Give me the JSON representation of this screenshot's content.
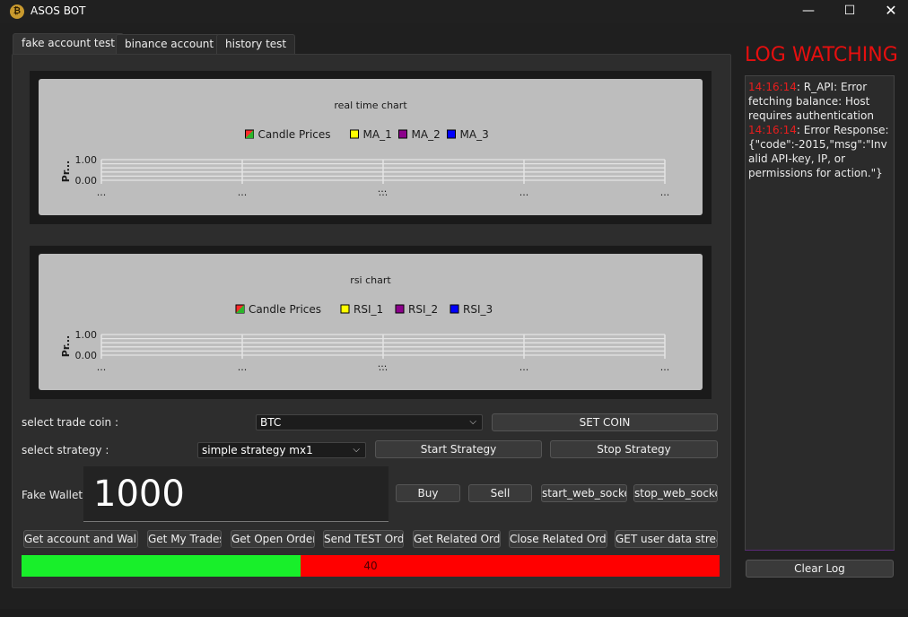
{
  "window": {
    "title": "ASOS BOT",
    "icon": "coin-icon",
    "minimize": "—",
    "maximize": "☐",
    "close": "✕"
  },
  "tabs": [
    {
      "label": "fake account test",
      "active": true
    },
    {
      "label": "binance account",
      "active": false
    },
    {
      "label": "history test",
      "active": false
    }
  ],
  "colors": {
    "candle": "#2bb52b",
    "ma1": "#ffff00",
    "ma2": "#8b008b",
    "ma3": "#0000ff",
    "progress_fill": "#18ef2a",
    "progress_bg": "#ff0000",
    "log_title": "#e50f0f"
  },
  "chart_data": [
    {
      "type": "line",
      "title": "real time chart",
      "ylabel": "Pr...",
      "legend": [
        "Candle Prices",
        "MA_1",
        "MA_2",
        "MA_3"
      ],
      "yticks": [
        "1.00",
        "0.00"
      ],
      "xticks": [
        "...",
        "...",
        "...",
        "...",
        "..."
      ],
      "ylim": [
        0,
        1
      ],
      "series": [
        {
          "name": "Candle Prices",
          "values": []
        },
        {
          "name": "MA_1",
          "values": []
        },
        {
          "name": "MA_2",
          "values": []
        },
        {
          "name": "MA_3",
          "values": []
        }
      ]
    },
    {
      "type": "line",
      "title": "rsi chart",
      "ylabel": "Pr...",
      "legend": [
        "Candle Prices",
        "RSI_1",
        "RSI_2",
        "RSI_3"
      ],
      "yticks": [
        "1.00",
        "0.00"
      ],
      "xticks": [
        "...",
        "...",
        "...",
        "...",
        "..."
      ],
      "ylim": [
        0,
        1
      ],
      "series": [
        {
          "name": "Candle Prices",
          "values": []
        },
        {
          "name": "RSI_1",
          "values": []
        },
        {
          "name": "RSI_2",
          "values": []
        },
        {
          "name": "RSI_3",
          "values": []
        }
      ]
    }
  ],
  "controls": {
    "trade_coin_label": "select trade coin :",
    "trade_coin_value": "BTC",
    "set_coin": "SET COIN",
    "strategy_label": "select strategy :",
    "strategy_value": "simple strategy mx1",
    "start_strategy": "Start Strategy",
    "stop_strategy": "Stop Strategy",
    "wallet_label": "Fake Wallet:",
    "wallet_value": "1000",
    "buy": "Buy",
    "sell": "Sell",
    "start_ws": "start_web_socket",
    "stop_ws": "stop_web_socket"
  },
  "actions": [
    "Get account and Wallet",
    "Get My Trades",
    "Get Open Orders",
    "Send TEST Order",
    "Get Related Order",
    "Close Related Order",
    "GET user data stream"
  ],
  "progress": {
    "value": 40,
    "fraction": 0.4,
    "text": "40"
  },
  "log": {
    "title": "LOG WATCHING",
    "entries": [
      {
        "time": "14:16:14",
        "text": ": R_API: Error fetching balance: Host requires authentication"
      },
      {
        "time": "14:16:14",
        "text": ": Error Response: {\"code\":-2015,\"msg\":\"Invalid API-key, IP, or permissions for action.\"}"
      }
    ],
    "clear": "Clear Log"
  }
}
